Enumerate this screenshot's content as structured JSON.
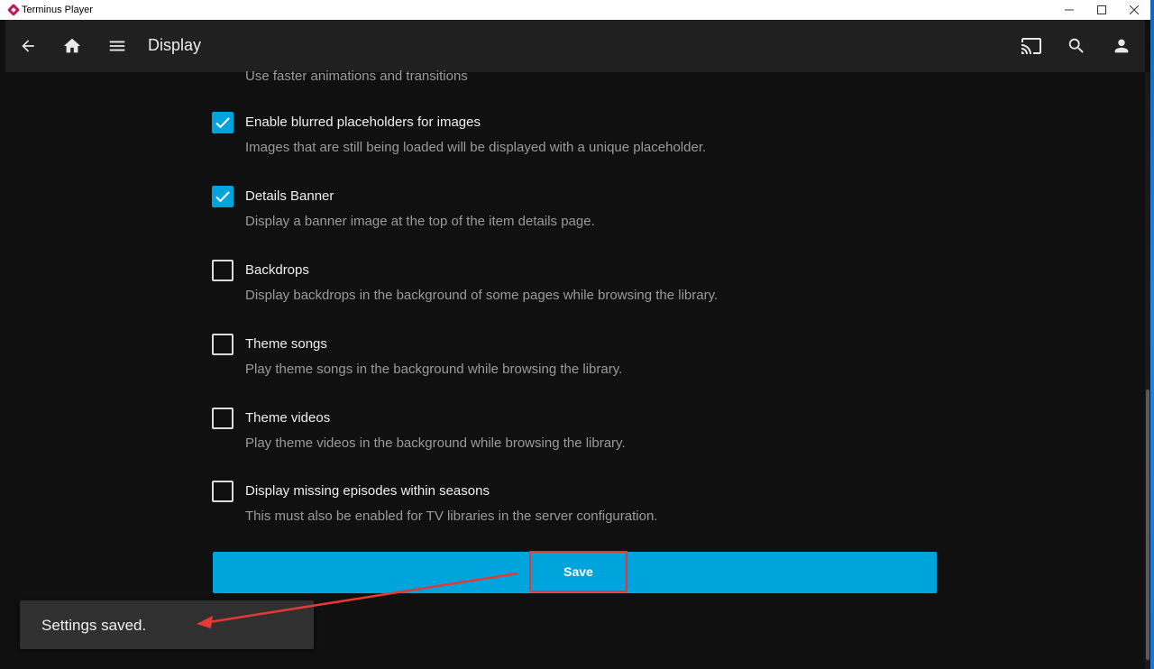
{
  "window": {
    "title": "Terminus Player"
  },
  "header": {
    "title": "Display",
    "icons": [
      "back-arrow-icon",
      "home-icon",
      "menu-icon",
      "cast-icon",
      "search-icon",
      "user-icon"
    ]
  },
  "settings": {
    "top_description": "Use faster animations and transitions",
    "options": [
      {
        "label": "Enable blurred placeholders for images",
        "description": "Images that are still being loaded will be displayed with a unique placeholder.",
        "checked": true
      },
      {
        "label": "Details Banner",
        "description": "Display a banner image at the top of the item details page.",
        "checked": true
      },
      {
        "label": "Backdrops",
        "description": "Display backdrops in the background of some pages while browsing the library.",
        "checked": false
      },
      {
        "label": "Theme songs",
        "description": "Play theme songs in the background while browsing the library.",
        "checked": false
      },
      {
        "label": "Theme videos",
        "description": "Play theme videos in the background while browsing the library.",
        "checked": false
      },
      {
        "label": "Display missing episodes within seasons",
        "description": "This must also be enabled for TV libraries in the server configuration.",
        "checked": false
      }
    ],
    "save_label": "Save"
  },
  "toast": {
    "message": "Settings saved."
  },
  "colors": {
    "accent": "#00a4dc",
    "annotation": "#e53935",
    "background": "#101010",
    "header": "#202020"
  }
}
